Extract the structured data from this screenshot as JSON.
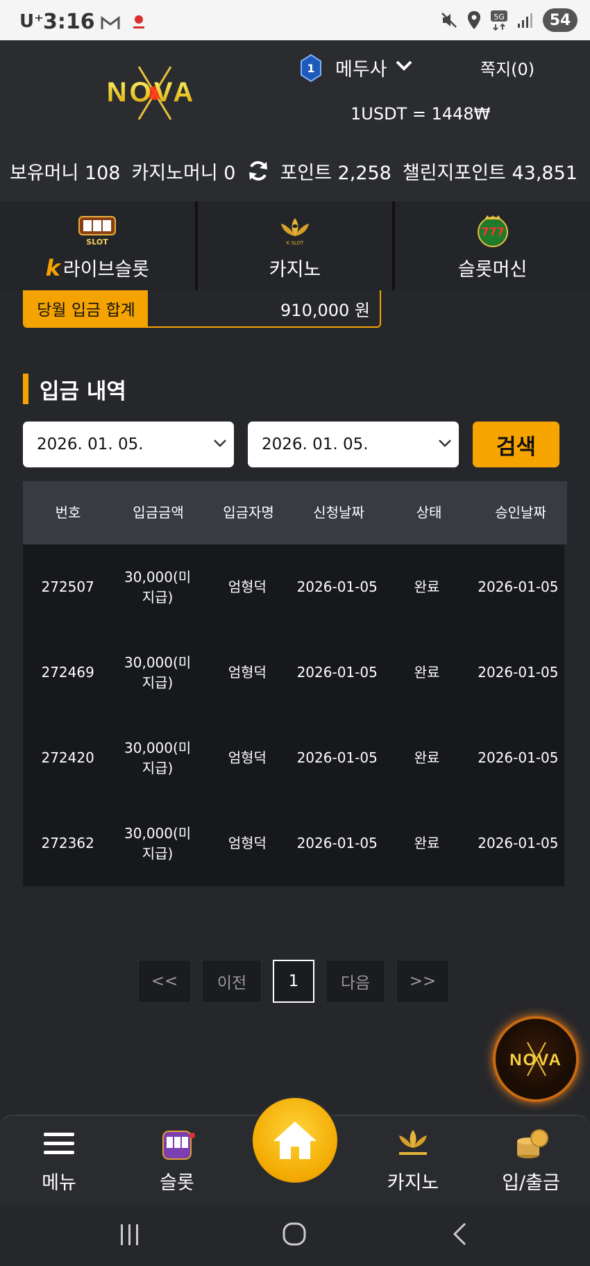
{
  "status_bar": {
    "carrier": "U⁺",
    "time": "3:16",
    "battery": "54",
    "network": "5G"
  },
  "header": {
    "logo_text": "NOVA",
    "level": "1",
    "nickname": "메두사",
    "messages": "쪽지(0)",
    "exchange_rate": "1USDT = 1448₩",
    "balances": {
      "holding_money": "보유머니 108",
      "casino_money": "카지노머니 0",
      "points": "포인트 2,258",
      "challenge_points": "챌린지포인트 43,851"
    }
  },
  "categories": [
    {
      "label": "라이브슬롯",
      "icon": "slot-machine-icon"
    },
    {
      "label": "카지노",
      "icon": "lotus-icon"
    },
    {
      "label": "슬롯머신",
      "icon": "777-slot-icon"
    }
  ],
  "monthly_total": {
    "label": "당월 입금 합계",
    "value": "910,000 원"
  },
  "section_title": "입금 내역",
  "filters": {
    "start_date": "2026. 01. 05.",
    "end_date": "2026. 01. 05.",
    "search_label": "검색"
  },
  "table": {
    "columns": [
      "번호",
      "입금금액",
      "입금자명",
      "신청날짜",
      "상태",
      "승인날짜"
    ],
    "rows": [
      [
        "272507",
        "30,000(미지급)",
        "엄형덕",
        "2026-01-05",
        "완료",
        "2026-01-05"
      ],
      [
        "272469",
        "30,000(미지급)",
        "엄형덕",
        "2026-01-05",
        "완료",
        "2026-01-05"
      ],
      [
        "272420",
        "30,000(미지급)",
        "엄형덕",
        "2026-01-05",
        "완료",
        "2026-01-05"
      ],
      [
        "272362",
        "30,000(미지급)",
        "엄형덕",
        "2026-01-05",
        "완료",
        "2026-01-05"
      ]
    ]
  },
  "pagination": {
    "first": "<<",
    "prev": "이전",
    "current": "1",
    "next": "다음",
    "last": ">>"
  },
  "bottom_nav": {
    "menu": "메뉴",
    "slot": "슬롯",
    "casino": "카지노",
    "deposit_withdraw": "입/출금"
  },
  "colors": {
    "accent": "#f5a300",
    "background": "#26272b",
    "table_header": "#393b42",
    "table_body": "#17181b"
  }
}
